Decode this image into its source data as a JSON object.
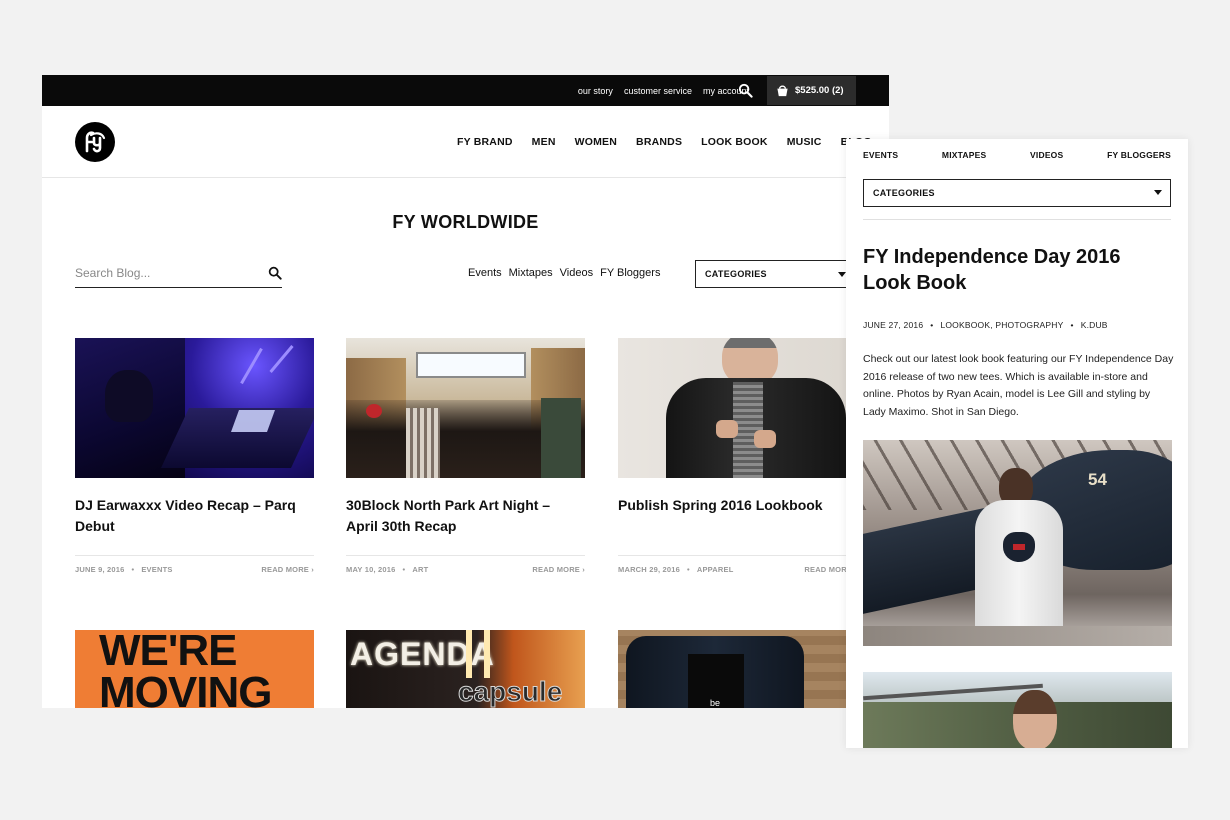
{
  "topbar": {
    "links": [
      "our story",
      "customer service",
      "my account"
    ],
    "cart_total": "$525.00 (2)"
  },
  "nav": [
    "FY BRAND",
    "MEN",
    "WOMEN",
    "BRANDS",
    "LOOK BOOK",
    "MUSIC",
    "BLOG"
  ],
  "page_title": "FY WORLDWIDE",
  "search": {
    "placeholder": "Search Blog..."
  },
  "filters": [
    "Events",
    "Mixtapes",
    "Videos",
    "FY Bloggers"
  ],
  "categories_label": "CATEGORIES",
  "posts": [
    {
      "title": "DJ Earwaxxx Video Recap – Parq Debut",
      "date": "JUNE 9, 2016",
      "category": "EVENTS",
      "more": "READ MORE ›"
    },
    {
      "title": "30Block North Park Art Night – April 30th Recap",
      "date": "MAY 10, 2016",
      "category": "ART",
      "more": "READ MORE ›"
    },
    {
      "title": "Publish Spring 2016 Lookbook",
      "date": "MARCH 29, 2016",
      "category": "APPAREL",
      "more": "READ MORE ›"
    }
  ],
  "row2_images": {
    "moving_line1": "WE'RE",
    "moving_line2": "MOVING",
    "agenda": "AGENDA",
    "capsule": "capsule"
  },
  "mobile": {
    "nav": [
      "EVENTS",
      "MIXTAPES",
      "VIDEOS",
      "FY BLOGGERS"
    ],
    "categories_label": "CATEGORIES",
    "title": "FY Independence Day 2016 Look Book",
    "date": "JUNE 27, 2016",
    "tags": "LOOKBOOK, PHOTOGRAPHY",
    "author": "K.DUB",
    "body": "Check out our latest look book featuring our FY Independence Day 2016 release of two new tees. Which is available in-store and online. Photos by Ryan Acain, model is Lee Gill and styling by Lady Maximo. Shot in San Diego.",
    "plane_number": "54"
  }
}
